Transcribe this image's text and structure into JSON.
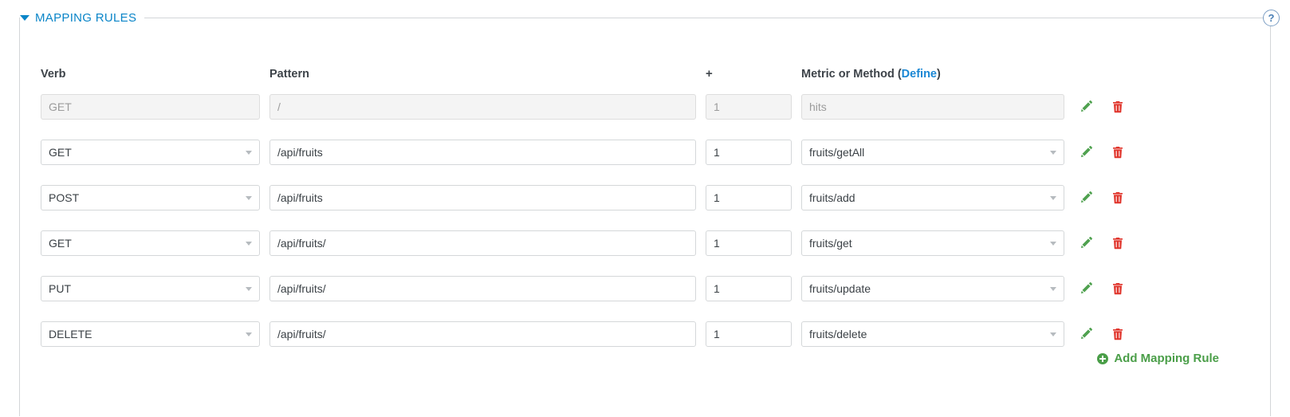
{
  "section": {
    "legend": "MAPPING RULES",
    "caret_icon": "caret-down-icon",
    "help_icon": "?",
    "accent_blue": "#0a85c8",
    "accent_green": "#4a9e48",
    "accent_red": "#e0342b"
  },
  "headers": {
    "verb": "Verb",
    "pattern": "Pattern",
    "delta": "+",
    "metric_prefix": "Metric or Method (",
    "metric_link": "Define",
    "metric_suffix": ")"
  },
  "placeholder_row": {
    "verb": "GET",
    "pattern": "/",
    "delta": "1",
    "metric": "hits",
    "disabled": true
  },
  "rows": [
    {
      "verb": "GET",
      "pattern": "/api/fruits",
      "delta": "1",
      "metric": "fruits/getAll"
    },
    {
      "verb": "POST",
      "pattern": "/api/fruits",
      "delta": "1",
      "metric": "fruits/add"
    },
    {
      "verb": "GET",
      "pattern": "/api/fruits/",
      "delta": "1",
      "metric": "fruits/get"
    },
    {
      "verb": "PUT",
      "pattern": "/api/fruits/",
      "delta": "1",
      "metric": "fruits/update"
    },
    {
      "verb": "DELETE",
      "pattern": "/api/fruits/",
      "delta": "1",
      "metric": "fruits/delete"
    }
  ],
  "actions": {
    "edit_icon": "pencil-icon",
    "delete_icon": "trash-icon"
  },
  "footer": {
    "add_label": "Add Mapping Rule",
    "add_icon": "plus-circle-icon"
  }
}
